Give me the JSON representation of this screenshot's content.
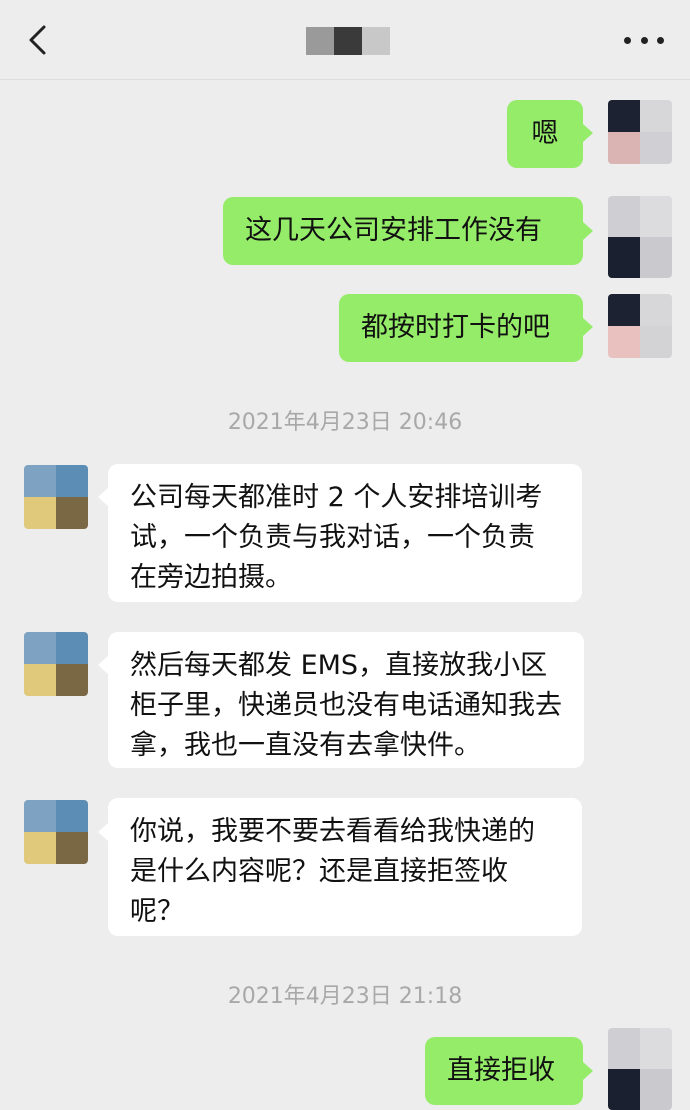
{
  "header": {
    "back_icon": "chevron-left-icon",
    "title_blurred": true,
    "more_icon": "ellipsis-icon"
  },
  "colors": {
    "background": "#ededed",
    "outgoing_bubble": "#95ec69",
    "incoming_bubble": "#ffffff",
    "timestamp_text": "#a8a8a8"
  },
  "messages": {
    "m1": "嗯",
    "m2": "这几天公司安排工作没有",
    "m3": "都按时打卡的吧",
    "ts1": "2021年4月23日 20:46",
    "m4": "公司每天都准时 2 个人安排培训考试，一个负责与我对话，一个负责在旁边拍摄。",
    "m5": "然后每天都发 EMS，直接放我小区柜子里，快递员也没有电话通知我去拿，我也一直没有去拿快件。",
    "m6": "你说，我要不要去看看给我快递的是什么内容呢？还是直接拒签收呢？",
    "ts2": "2021年4月23日 21:18",
    "m7": "直接拒收"
  }
}
